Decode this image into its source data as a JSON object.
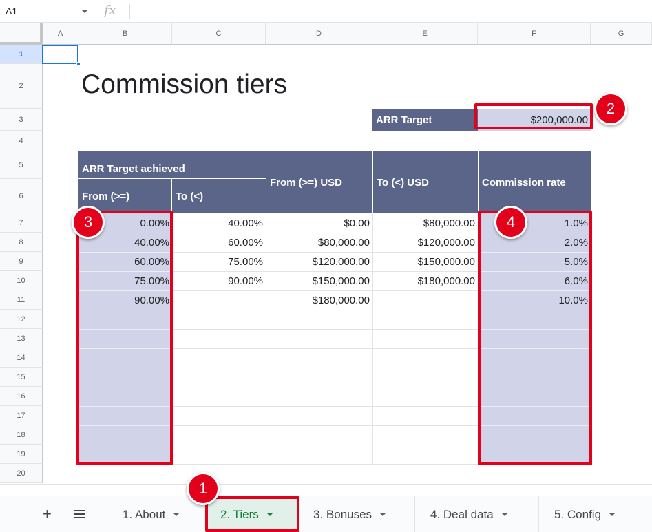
{
  "formula_bar": {
    "cell_ref": "A1",
    "fx_label": "fx"
  },
  "columns": [
    "A",
    "B",
    "C",
    "D",
    "E",
    "F",
    "G"
  ],
  "rows": [
    "1",
    "2",
    "3",
    "4",
    "5",
    "6",
    "7",
    "8",
    "9",
    "10",
    "11",
    "12",
    "13",
    "14",
    "15",
    "16",
    "17",
    "18",
    "19",
    "20"
  ],
  "sheet": {
    "title": "Commission tiers",
    "arr_target_label": "ARR Target",
    "arr_target_value": "$200,000.00",
    "header_group": "ARR Target achieved",
    "header_from": "From (>=)",
    "header_to": "To (<)",
    "header_from_usd": "From (>=) USD",
    "header_to_usd": "To (<) USD",
    "header_rate": "Commission rate",
    "table": [
      {
        "from": "0.00%",
        "to": "40.00%",
        "from_usd": "$0.00",
        "to_usd": "$80,000.00",
        "rate": "1.0%"
      },
      {
        "from": "40.00%",
        "to": "60.00%",
        "from_usd": "$80,000.00",
        "to_usd": "$120,000.00",
        "rate": "2.0%"
      },
      {
        "from": "60.00%",
        "to": "75.00%",
        "from_usd": "$120,000.00",
        "to_usd": "$150,000.00",
        "rate": "5.0%"
      },
      {
        "from": "75.00%",
        "to": "90.00%",
        "from_usd": "$150,000.00",
        "to_usd": "$180,000.00",
        "rate": "6.0%"
      },
      {
        "from": "90.00%",
        "to": "",
        "from_usd": "$180,000.00",
        "to_usd": "",
        "rate": "10.0%"
      }
    ]
  },
  "callouts": [
    "1",
    "2",
    "3",
    "4"
  ],
  "tabs": [
    {
      "label": "1. About",
      "active": false
    },
    {
      "label": "2. Tiers",
      "active": true
    },
    {
      "label": "3. Bonuses",
      "active": false
    },
    {
      "label": "4. Deal data",
      "active": false
    },
    {
      "label": "5. Config",
      "active": false
    }
  ],
  "colors": {
    "header_bg": "#5b6589",
    "input_fill": "#d1d3e8",
    "callout_red": "#e2001a",
    "active_tab": "#188038"
  },
  "icons": {
    "add_sheet": "+",
    "all_sheets": "list-icon",
    "function": "fx-icon"
  }
}
